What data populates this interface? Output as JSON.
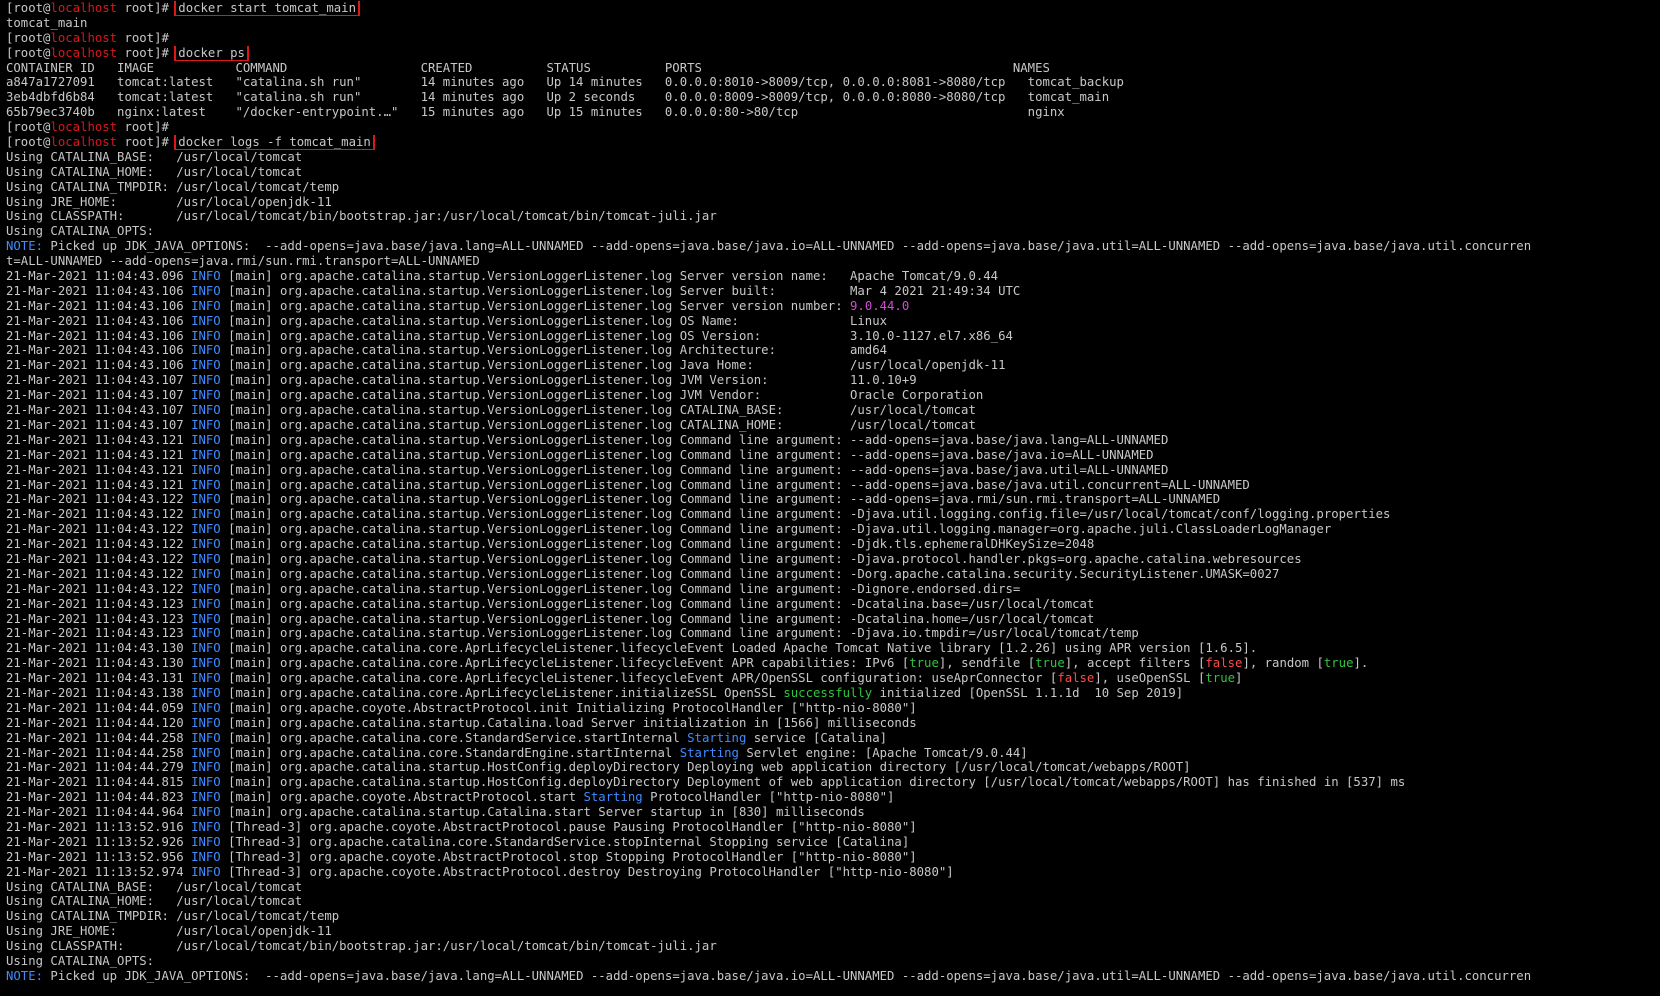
{
  "prompt": {
    "user": "[root@",
    "host": "localhost",
    "path": " root]# "
  },
  "colors": {
    "host": "#d8181c",
    "info": "#3f8cff",
    "highlight_box": "#e0161c",
    "magenta": "#d24bd2",
    "green": "#2fc43f",
    "red": "#ff4a4a"
  },
  "lines": [
    {
      "type": "prompt",
      "cmd": "docker start tomcat_main",
      "boxed": true
    },
    {
      "type": "text",
      "text": "tomcat_main"
    },
    {
      "type": "prompt",
      "cmd": "",
      "boxed": false
    },
    {
      "type": "prompt",
      "cmd": "docker ps",
      "boxed": true
    },
    {
      "type": "text",
      "text": "CONTAINER ID   IMAGE           COMMAND                  CREATED          STATUS          PORTS                                          NAMES"
    },
    {
      "type": "text",
      "text": "a847a1727091   tomcat:latest   \"catalina.sh run\"        14 minutes ago   Up 14 minutes   0.0.0.0:8010->8009/tcp, 0.0.0.0:8081->8080/tcp   tomcat_backup"
    },
    {
      "type": "text",
      "text": "3eb4dbfd6b84   tomcat:latest   \"catalina.sh run\"        14 minutes ago   Up 2 seconds    0.0.0.0:8009->8009/tcp, 0.0.0.0:8080->8080/tcp   tomcat_main"
    },
    {
      "type": "text",
      "text": "65b79ec3740b   nginx:latest    \"/docker-entrypoint.…\"   15 minutes ago   Up 15 minutes   0.0.0.0:80->80/tcp                               nginx"
    },
    {
      "type": "prompt",
      "cmd": "",
      "boxed": false
    },
    {
      "type": "prompt",
      "cmd": "docker logs -f tomcat_main",
      "boxed": true
    },
    {
      "type": "text",
      "text": "Using CATALINA_BASE:   /usr/local/tomcat"
    },
    {
      "type": "text",
      "text": "Using CATALINA_HOME:   /usr/local/tomcat"
    },
    {
      "type": "text",
      "text": "Using CATALINA_TMPDIR: /usr/local/tomcat/temp"
    },
    {
      "type": "text",
      "text": "Using JRE_HOME:        /usr/local/openjdk-11"
    },
    {
      "type": "text",
      "text": "Using CLASSPATH:       /usr/local/tomcat/bin/bootstrap.jar:/usr/local/tomcat/bin/tomcat-juli.jar"
    },
    {
      "type": "text",
      "text": "Using CATALINA_OPTS:"
    },
    {
      "type": "note",
      "label": "NOTE:",
      "text": " Picked up JDK_JAVA_OPTIONS:  --add-opens=java.base/java.lang=ALL-UNNAMED --add-opens=java.base/java.io=ALL-UNNAMED --add-opens=java.base/java.util=ALL-UNNAMED --add-opens=java.base/java.util.concurren"
    },
    {
      "type": "text",
      "text": "t=ALL-UNNAMED --add-opens=java.rmi/sun.rmi.transport=ALL-UNNAMED"
    },
    {
      "type": "log",
      "ts": "21-Mar-2021 11:04:43.096",
      "lvl": "INFO",
      "parts": [
        {
          "t": " [main] org.apache.catalina.startup.VersionLoggerListener.log Server version name:   Apache Tomcat/9.0.44"
        }
      ]
    },
    {
      "type": "log",
      "ts": "21-Mar-2021 11:04:43.106",
      "lvl": "INFO",
      "parts": [
        {
          "t": " [main] org.apache.catalina.startup.VersionLoggerListener.log Server built:          Mar 4 2021 21:49:34 UTC"
        }
      ]
    },
    {
      "type": "log",
      "ts": "21-Mar-2021 11:04:43.106",
      "lvl": "INFO",
      "parts": [
        {
          "t": " [main] org.apache.catalina.startup.VersionLoggerListener.log Server version number: "
        },
        {
          "t": "9.0.44.0",
          "c": "magenta"
        }
      ]
    },
    {
      "type": "log",
      "ts": "21-Mar-2021 11:04:43.106",
      "lvl": "INFO",
      "parts": [
        {
          "t": " [main] org.apache.catalina.startup.VersionLoggerListener.log OS Name:               Linux"
        }
      ]
    },
    {
      "type": "log",
      "ts": "21-Mar-2021 11:04:43.106",
      "lvl": "INFO",
      "parts": [
        {
          "t": " [main] org.apache.catalina.startup.VersionLoggerListener.log OS Version:            3.10.0-1127.el7.x86_64"
        }
      ]
    },
    {
      "type": "log",
      "ts": "21-Mar-2021 11:04:43.106",
      "lvl": "INFO",
      "parts": [
        {
          "t": " [main] org.apache.catalina.startup.VersionLoggerListener.log Architecture:          amd64"
        }
      ]
    },
    {
      "type": "log",
      "ts": "21-Mar-2021 11:04:43.106",
      "lvl": "INFO",
      "parts": [
        {
          "t": " [main] org.apache.catalina.startup.VersionLoggerListener.log Java Home:             /usr/local/openjdk-11"
        }
      ]
    },
    {
      "type": "log",
      "ts": "21-Mar-2021 11:04:43.107",
      "lvl": "INFO",
      "parts": [
        {
          "t": " [main] org.apache.catalina.startup.VersionLoggerListener.log JVM Version:           11.0.10+9"
        }
      ]
    },
    {
      "type": "log",
      "ts": "21-Mar-2021 11:04:43.107",
      "lvl": "INFO",
      "parts": [
        {
          "t": " [main] org.apache.catalina.startup.VersionLoggerListener.log JVM Vendor:            Oracle Corporation"
        }
      ]
    },
    {
      "type": "log",
      "ts": "21-Mar-2021 11:04:43.107",
      "lvl": "INFO",
      "parts": [
        {
          "t": " [main] org.apache.catalina.startup.VersionLoggerListener.log CATALINA_BASE:         /usr/local/tomcat"
        }
      ]
    },
    {
      "type": "log",
      "ts": "21-Mar-2021 11:04:43.107",
      "lvl": "INFO",
      "parts": [
        {
          "t": " [main] org.apache.catalina.startup.VersionLoggerListener.log CATALINA_HOME:         /usr/local/tomcat"
        }
      ]
    },
    {
      "type": "log",
      "ts": "21-Mar-2021 11:04:43.121",
      "lvl": "INFO",
      "parts": [
        {
          "t": " [main] org.apache.catalina.startup.VersionLoggerListener.log Command line argument: --add-opens=java.base/java.lang=ALL-UNNAMED"
        }
      ]
    },
    {
      "type": "log",
      "ts": "21-Mar-2021 11:04:43.121",
      "lvl": "INFO",
      "parts": [
        {
          "t": " [main] org.apache.catalina.startup.VersionLoggerListener.log Command line argument: --add-opens=java.base/java.io=ALL-UNNAMED"
        }
      ]
    },
    {
      "type": "log",
      "ts": "21-Mar-2021 11:04:43.121",
      "lvl": "INFO",
      "parts": [
        {
          "t": " [main] org.apache.catalina.startup.VersionLoggerListener.log Command line argument: --add-opens=java.base/java.util=ALL-UNNAMED"
        }
      ]
    },
    {
      "type": "log",
      "ts": "21-Mar-2021 11:04:43.121",
      "lvl": "INFO",
      "parts": [
        {
          "t": " [main] org.apache.catalina.startup.VersionLoggerListener.log Command line argument: --add-opens=java.base/java.util.concurrent=ALL-UNNAMED"
        }
      ]
    },
    {
      "type": "log",
      "ts": "21-Mar-2021 11:04:43.122",
      "lvl": "INFO",
      "parts": [
        {
          "t": " [main] org.apache.catalina.startup.VersionLoggerListener.log Command line argument: --add-opens=java.rmi/sun.rmi.transport=ALL-UNNAMED"
        }
      ]
    },
    {
      "type": "log",
      "ts": "21-Mar-2021 11:04:43.122",
      "lvl": "INFO",
      "parts": [
        {
          "t": " [main] org.apache.catalina.startup.VersionLoggerListener.log Command line argument: -Djava.util.logging.config.file=/usr/local/tomcat/conf/logging.properties"
        }
      ]
    },
    {
      "type": "log",
      "ts": "21-Mar-2021 11:04:43.122",
      "lvl": "INFO",
      "parts": [
        {
          "t": " [main] org.apache.catalina.startup.VersionLoggerListener.log Command line argument: -Djava.util.logging.manager=org.apache.juli.ClassLoaderLogManager"
        }
      ]
    },
    {
      "type": "log",
      "ts": "21-Mar-2021 11:04:43.122",
      "lvl": "INFO",
      "parts": [
        {
          "t": " [main] org.apache.catalina.startup.VersionLoggerListener.log Command line argument: -Djdk.tls.ephemeralDHKeySize=2048"
        }
      ]
    },
    {
      "type": "log",
      "ts": "21-Mar-2021 11:04:43.122",
      "lvl": "INFO",
      "parts": [
        {
          "t": " [main] org.apache.catalina.startup.VersionLoggerListener.log Command line argument: -Djava.protocol.handler.pkgs=org.apache.catalina.webresources"
        }
      ]
    },
    {
      "type": "log",
      "ts": "21-Mar-2021 11:04:43.122",
      "lvl": "INFO",
      "parts": [
        {
          "t": " [main] org.apache.catalina.startup.VersionLoggerListener.log Command line argument: -Dorg.apache.catalina.security.SecurityListener.UMASK=0027"
        }
      ]
    },
    {
      "type": "log",
      "ts": "21-Mar-2021 11:04:43.122",
      "lvl": "INFO",
      "parts": [
        {
          "t": " [main] org.apache.catalina.startup.VersionLoggerListener.log Command line argument: -Dignore.endorsed.dirs="
        }
      ]
    },
    {
      "type": "log",
      "ts": "21-Mar-2021 11:04:43.123",
      "lvl": "INFO",
      "parts": [
        {
          "t": " [main] org.apache.catalina.startup.VersionLoggerListener.log Command line argument: -Dcatalina.base=/usr/local/tomcat"
        }
      ]
    },
    {
      "type": "log",
      "ts": "21-Mar-2021 11:04:43.123",
      "lvl": "INFO",
      "parts": [
        {
          "t": " [main] org.apache.catalina.startup.VersionLoggerListener.log Command line argument: -Dcatalina.home=/usr/local/tomcat"
        }
      ]
    },
    {
      "type": "log",
      "ts": "21-Mar-2021 11:04:43.123",
      "lvl": "INFO",
      "parts": [
        {
          "t": " [main] org.apache.catalina.startup.VersionLoggerListener.log Command line argument: -Djava.io.tmpdir=/usr/local/tomcat/temp"
        }
      ]
    },
    {
      "type": "log",
      "ts": "21-Mar-2021 11:04:43.130",
      "lvl": "INFO",
      "parts": [
        {
          "t": " [main] org.apache.catalina.core.AprLifecycleListener.lifecycleEvent Loaded Apache Tomcat Native library [1.2.26] using APR version [1.6.5]."
        }
      ]
    },
    {
      "type": "log",
      "ts": "21-Mar-2021 11:04:43.130",
      "lvl": "INFO",
      "parts": [
        {
          "t": " [main] org.apache.catalina.core.AprLifecycleListener.lifecycleEvent APR capabilities: IPv6 ["
        },
        {
          "t": "true",
          "c": "green"
        },
        {
          "t": "], sendfile ["
        },
        {
          "t": "true",
          "c": "green"
        },
        {
          "t": "], accept filters ["
        },
        {
          "t": "false",
          "c": "red"
        },
        {
          "t": "], random ["
        },
        {
          "t": "true",
          "c": "green"
        },
        {
          "t": "]."
        }
      ]
    },
    {
      "type": "log",
      "ts": "21-Mar-2021 11:04:43.131",
      "lvl": "INFO",
      "parts": [
        {
          "t": " [main] org.apache.catalina.core.AprLifecycleListener.lifecycleEvent APR/OpenSSL configuration: useAprConnector ["
        },
        {
          "t": "false",
          "c": "red"
        },
        {
          "t": "], useOpenSSL ["
        },
        {
          "t": "true",
          "c": "green"
        },
        {
          "t": "]"
        }
      ]
    },
    {
      "type": "log",
      "ts": "21-Mar-2021 11:04:43.138",
      "lvl": "INFO",
      "parts": [
        {
          "t": " [main] org.apache.catalina.core.AprLifecycleListener.initializeSSL OpenSSL "
        },
        {
          "t": "successfully",
          "c": "green"
        },
        {
          "t": " initialized [OpenSSL 1.1.1d  10 Sep 2019]"
        }
      ]
    },
    {
      "type": "log",
      "ts": "21-Mar-2021 11:04:44.059",
      "lvl": "INFO",
      "parts": [
        {
          "t": " [main] org.apache.coyote.AbstractProtocol.init Initializing ProtocolHandler [\"http-nio-8080\"]"
        }
      ]
    },
    {
      "type": "log",
      "ts": "21-Mar-2021 11:04:44.120",
      "lvl": "INFO",
      "parts": [
        {
          "t": " [main] org.apache.catalina.startup.Catalina.load Server initialization in [1566] milliseconds"
        }
      ]
    },
    {
      "type": "log",
      "ts": "21-Mar-2021 11:04:44.258",
      "lvl": "INFO",
      "parts": [
        {
          "t": " [main] org.apache.catalina.core.StandardService.startInternal "
        },
        {
          "t": "Starting",
          "c": "info"
        },
        {
          "t": " service [Catalina]"
        }
      ]
    },
    {
      "type": "log",
      "ts": "21-Mar-2021 11:04:44.258",
      "lvl": "INFO",
      "parts": [
        {
          "t": " [main] org.apache.catalina.core.StandardEngine.startInternal "
        },
        {
          "t": "Starting",
          "c": "info"
        },
        {
          "t": " Servlet engine: [Apache Tomcat/9.0.44]"
        }
      ]
    },
    {
      "type": "log",
      "ts": "21-Mar-2021 11:04:44.279",
      "lvl": "INFO",
      "parts": [
        {
          "t": " [main] org.apache.catalina.startup.HostConfig.deployDirectory Deploying web application directory [/usr/local/tomcat/webapps/ROOT]"
        }
      ]
    },
    {
      "type": "log",
      "ts": "21-Mar-2021 11:04:44.815",
      "lvl": "INFO",
      "parts": [
        {
          "t": " [main] org.apache.catalina.startup.HostConfig.deployDirectory Deployment of web application directory [/usr/local/tomcat/webapps/ROOT] has finished in [537] ms"
        }
      ]
    },
    {
      "type": "log",
      "ts": "21-Mar-2021 11:04:44.823",
      "lvl": "INFO",
      "parts": [
        {
          "t": " [main] org.apache.coyote.AbstractProtocol.start "
        },
        {
          "t": "Starting",
          "c": "info"
        },
        {
          "t": " ProtocolHandler [\"http-nio-8080\"]"
        }
      ]
    },
    {
      "type": "log",
      "ts": "21-Mar-2021 11:04:44.964",
      "lvl": "INFO",
      "parts": [
        {
          "t": " [main] org.apache.catalina.startup.Catalina.start Server startup in [830] milliseconds"
        }
      ]
    },
    {
      "type": "log",
      "ts": "21-Mar-2021 11:13:52.916",
      "lvl": "INFO",
      "parts": [
        {
          "t": " [Thread-3] org.apache.coyote.AbstractProtocol.pause Pausing ProtocolHandler [\"http-nio-8080\"]"
        }
      ]
    },
    {
      "type": "log",
      "ts": "21-Mar-2021 11:13:52.926",
      "lvl": "INFO",
      "parts": [
        {
          "t": " [Thread-3] org.apache.catalina.core.StandardService.stopInternal Stopping service [Catalina]"
        }
      ]
    },
    {
      "type": "log",
      "ts": "21-Mar-2021 11:13:52.956",
      "lvl": "INFO",
      "parts": [
        {
          "t": " [Thread-3] org.apache.coyote.AbstractProtocol.stop Stopping ProtocolHandler [\"http-nio-8080\"]"
        }
      ]
    },
    {
      "type": "log",
      "ts": "21-Mar-2021 11:13:52.974",
      "lvl": "INFO",
      "parts": [
        {
          "t": " [Thread-3] org.apache.coyote.AbstractProtocol.destroy Destroying ProtocolHandler [\"http-nio-8080\"]"
        }
      ]
    },
    {
      "type": "text",
      "text": "Using CATALINA_BASE:   /usr/local/tomcat"
    },
    {
      "type": "text",
      "text": "Using CATALINA_HOME:   /usr/local/tomcat"
    },
    {
      "type": "text",
      "text": "Using CATALINA_TMPDIR: /usr/local/tomcat/temp"
    },
    {
      "type": "text",
      "text": "Using JRE_HOME:        /usr/local/openjdk-11"
    },
    {
      "type": "text",
      "text": "Using CLASSPATH:       /usr/local/tomcat/bin/bootstrap.jar:/usr/local/tomcat/bin/tomcat-juli.jar"
    },
    {
      "type": "text",
      "text": "Using CATALINA_OPTS:"
    },
    {
      "type": "note",
      "label": "NOTE:",
      "text": " Picked up JDK_JAVA_OPTIONS:  --add-opens=java.base/java.lang=ALL-UNNAMED --add-opens=java.base/java.io=ALL-UNNAMED --add-opens=java.base/java.util=ALL-UNNAMED --add-opens=java.base/java.util.concurren"
    }
  ]
}
